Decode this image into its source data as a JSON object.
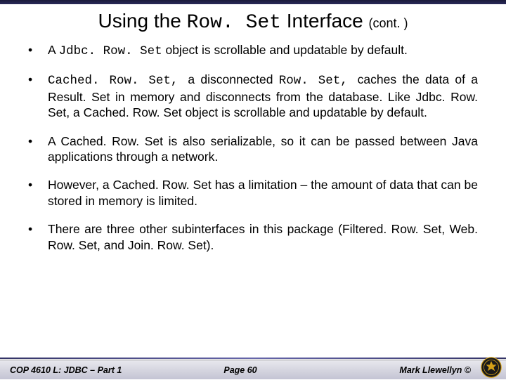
{
  "title": {
    "part1": "Using the ",
    "mono": "Row. Set",
    "part2": " Interface ",
    "cont": "(cont. )"
  },
  "bullets": [
    {
      "segments": [
        {
          "text": "A ",
          "mono": false
        },
        {
          "text": "Jdbc. Row. Set",
          "mono": true
        },
        {
          "text": " object is scrollable and updatable by default.",
          "mono": false
        }
      ]
    },
    {
      "segments": [
        {
          "text": "Cached. Row. Set, ",
          "mono": true
        },
        {
          "text": "a disconnected ",
          "mono": false
        },
        {
          "text": "Row. Set, ",
          "mono": true
        },
        {
          "text": "caches the data of a Result. Set in memory and disconnects from the database. Like Jdbc. Row. Set, a Cached. Row. Set object is scrollable and updatable by default.",
          "mono": false
        }
      ]
    },
    {
      "segments": [
        {
          "text": "A Cached. Row. Set is also serializable, so it can be passed between Java applications through a network.",
          "mono": false
        }
      ]
    },
    {
      "segments": [
        {
          "text": "However, a Cached. Row. Set has a limitation – the amount of data that can be stored in memory is limited.",
          "mono": false
        }
      ]
    },
    {
      "segments": [
        {
          "text": "There are three other subinterfaces in this package (Filtered. Row. Set, Web. Row. Set, and Join. Row. Set).",
          "mono": false
        }
      ]
    }
  ],
  "footer": {
    "left": "COP 4610 L: JDBC – Part 1",
    "center": "Page 60",
    "right": "Mark Llewellyn ©"
  }
}
